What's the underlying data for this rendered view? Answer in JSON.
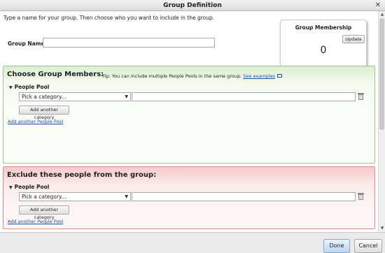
{
  "window": {
    "title": "Group Definition",
    "close_icon": "close-icon"
  },
  "intro_text": "Type a name for your group. Then choose who you want to include in the group.",
  "group_name": {
    "label": "Group Name",
    "value": ""
  },
  "membership": {
    "title": "Group Membership",
    "update_label": "Update",
    "count": "0"
  },
  "include_panel": {
    "title": "Choose Group Members:",
    "tip": "Tip: You can include multiple People Pools in the same group.",
    "see_examples": "See examples",
    "pool_label": "People Pool",
    "category_select": "Pick a category...",
    "add_category_label": "Add another category",
    "add_pool_label": "Add another People Pool",
    "color": "#dcefd1"
  },
  "exclude_panel": {
    "title": "Exclude these people from the group:",
    "pool_label": "People Pool",
    "category_select": "Pick a category...",
    "add_category_label": "Add another category",
    "add_pool_label": "Add another People Pool",
    "color": "#f7caca"
  },
  "footer": {
    "done_label": "Done",
    "cancel_label": "Cancel"
  }
}
